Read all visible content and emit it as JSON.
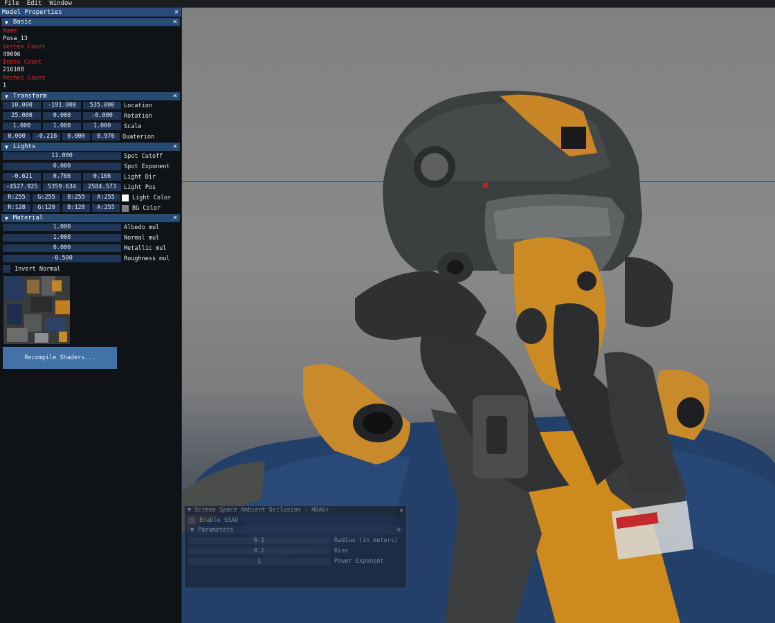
{
  "menu": {
    "items": [
      "File",
      "Edit",
      "Window"
    ]
  },
  "panel": {
    "title": "Model Properties",
    "basic": {
      "header": "Basic",
      "name_label": "Name",
      "name_value": "Posa_13",
      "vertex_label": "Vertex Count",
      "vertex_value": "49096",
      "index_label": "Index Count",
      "index_value": "216108",
      "meshes_label": "Meshes Count",
      "meshes_value": "1"
    },
    "transform": {
      "header": "Transform",
      "location": {
        "label": "Location",
        "values": [
          "10.000",
          "-191.000",
          "535.000"
        ]
      },
      "rotation": {
        "label": "Rotation",
        "values": [
          "25.000",
          "0.000",
          "-0.000"
        ]
      },
      "scale": {
        "label": "Scale",
        "values": [
          "1.000",
          "1.000",
          "1.000"
        ]
      },
      "quaterion": {
        "label": "Quaterion",
        "values": [
          "0.000",
          "-0.216",
          "0.000",
          "0.976"
        ]
      }
    },
    "lights": {
      "header": "Lights",
      "spot_cutoff": {
        "label": "Spot Cutoff",
        "value": "11.000"
      },
      "spot_exponent": {
        "label": "Spot Exponent",
        "value": "0.000"
      },
      "light_dir": {
        "label": "Light Dir",
        "values": [
          "-0.621",
          "0.766",
          "0.166"
        ]
      },
      "light_pos": {
        "label": "Light Pos",
        "values": [
          "-4527.925",
          "5359.634",
          "2584.573"
        ]
      },
      "light_color": {
        "label": "Light Color",
        "values": [
          "R:255",
          "G:255",
          "B:255",
          "A:255"
        ],
        "swatch": "#ffffff"
      },
      "bg_color": {
        "label": "BG Color",
        "values": [
          "R:128",
          "G:128",
          "B:128",
          "A:255"
        ],
        "swatch": "#808080"
      }
    },
    "material": {
      "header": "Material",
      "albedo": {
        "label": "Albedo mul",
        "value": "1.000"
      },
      "normal": {
        "label": "Normal mul",
        "value": "1.000"
      },
      "metallic": {
        "label": "Metallic mul",
        "value": "0.000"
      },
      "roughness": {
        "label": "Roughness mul",
        "value": "-0.500"
      },
      "invert_normal": {
        "label": "Invert Normal",
        "checked": false
      },
      "recompile_label": "Recompile Shaders..."
    }
  },
  "ssao": {
    "title": "Screen Space Ambient Occlusion - HBAO+",
    "enable_label": "Enable SSAO",
    "params_header": "Parameters",
    "radius": {
      "value": "0.1",
      "label": "Radius (in meters)"
    },
    "bias": {
      "value": "0.1",
      "label": "Bias"
    },
    "power": {
      "value": "1",
      "label": "Power Exponent"
    }
  },
  "colors": {
    "titlebar": "#294a7a",
    "header": "#284b74",
    "field": "#1f3656",
    "button": "#4272a8",
    "label_red": "#e8292a",
    "horizon_line": "#c21818"
  }
}
